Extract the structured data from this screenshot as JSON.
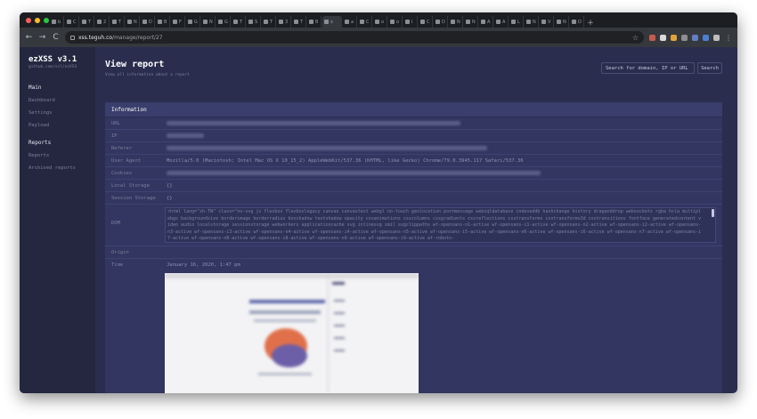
{
  "browser": {
    "tabs": [
      "b",
      "C",
      "T",
      "2",
      "T",
      "N",
      "D",
      "B",
      "F",
      "G",
      "N",
      "G",
      "T",
      "S",
      "T",
      "3",
      "T",
      "B",
      "a",
      "C",
      "o",
      "o",
      "I",
      "C",
      "D",
      "N",
      "N",
      "A",
      "A",
      "L",
      "N",
      "V",
      "N",
      "D"
    ],
    "active_tab": "x",
    "new_tab": "+",
    "url_host": "xss.teguh.co",
    "url_path": "/manage/report/27",
    "back": "←",
    "forward": "→",
    "reload": "C",
    "star": "☆",
    "menu": "⋮",
    "ext_colors": [
      "#c75b4a",
      "#d9d9d9",
      "#e0a23a",
      "#8e8e8e",
      "#5f7ec4",
      "#4c7fd4",
      "#bdbdbd"
    ]
  },
  "sidebar": {
    "brand": "ezXSS v3.1",
    "brand_sub": "github.com/ssl/ezXSS",
    "sections": [
      {
        "title": "Main",
        "items": [
          "Dashboard",
          "Settings",
          "Payload"
        ]
      },
      {
        "title": "Reports",
        "items": [
          "Reports",
          "Archived reports"
        ]
      }
    ]
  },
  "header": {
    "title": "View report",
    "subtitle": "View all information about a report",
    "search_placeholder": "Search for domain, IP or URL",
    "search_button": "Search"
  },
  "card": {
    "title": "Information",
    "rows": [
      {
        "key": "URL",
        "value": ""
      },
      {
        "key": "IP",
        "value": ""
      },
      {
        "key": "Referer",
        "value": ""
      },
      {
        "key": "User Agent",
        "value": "Mozilla/5.0 (Macintosh; Intel Mac OS X 10_15_2) AppleWebKit/537.36 (KHTML, like Gecko) Chrome/79.0.3945.117 Safari/537.36"
      },
      {
        "key": "Cookies",
        "value": ""
      },
      {
        "key": "Local Storage",
        "value": "{}"
      },
      {
        "key": "Session Storage",
        "value": "{}"
      },
      {
        "key": "DOM",
        "value": "<html lang=\"zh-TW\" class=\"no-svg js flexbox flexboxlegacy canvas canvastext webgl no-touch geolocation postmessage websqldatabase indexeddb hashchange history draganddrop websockets rgba hsla multiplebgs backgroundsize borderimage borderradius boxshadow textshadow opacity cssanimations csscolumns cssgradients cssreflections csstransforms csstransforms3d csstransitions fontface generatedcontent video audio localstorage sessionstorage webworkers applicationcache svg inlinesvg smil svgclippaths wf-opensans-n1-active wf-opensans-i1-active wf-opensans-n2-active wf-opensans-i2-active wf-opensans-n3-active wf-opensans-i3-active wf-opensans-n4-active wf-opensans-i4-active wf-opensans-n5-active wf-opensans-i5-active wf-opensans-n6-active wf-opensans-i6-active wf-opensans-n7-active wf-opensans-i7-active wf-opensans-n8-active wf-opensans-i8-active wf-opensans-n9-active wf-opensans-i9-active wf-roboto-"
      },
      {
        "key": "Origin",
        "value": ""
      },
      {
        "key": "Time",
        "value": "January 16, 2020, 1:47 pm"
      }
    ]
  },
  "colors": {
    "app_bg": "#2a2d4e",
    "sidebar_bg": "#24273f",
    "card_bg": "#323660",
    "muted_text": "#7c80a0"
  }
}
